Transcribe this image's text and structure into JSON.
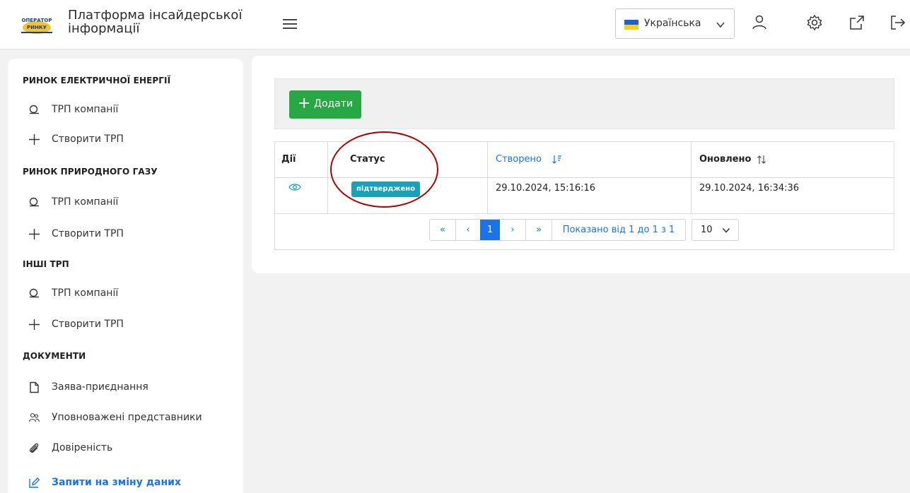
{
  "header": {
    "app_title": "Платформа інсайдерської інформації",
    "language": "Українська",
    "logo_text_top": "ОПЕРАТОР",
    "logo_text_mid": "РИНКУ"
  },
  "sidebar": {
    "sections": [
      {
        "title": "РИНОК ЕЛЕКТРИЧНОЇ ЕНЕРГІЇ",
        "items": [
          {
            "label": "ТРП компанії",
            "icon": "search-icon"
          },
          {
            "label": "Створити ТРП",
            "icon": "plus-icon"
          }
        ]
      },
      {
        "title": "РИНОК ПРИРОДНОГО ГАЗУ",
        "items": [
          {
            "label": "ТРП компанії",
            "icon": "search-icon"
          },
          {
            "label": "Створити ТРП",
            "icon": "plus-icon"
          }
        ]
      },
      {
        "title": "ІНШІ ТРП",
        "items": [
          {
            "label": "ТРП компанії",
            "icon": "search-icon"
          },
          {
            "label": "Створити ТРП",
            "icon": "plus-icon"
          }
        ]
      },
      {
        "title": "ДОКУМЕНТИ",
        "items": [
          {
            "label": "Заява-приєднання",
            "icon": "document-icon"
          },
          {
            "label": "Уповноважені представники",
            "icon": "users-icon"
          },
          {
            "label": "Довіреність",
            "icon": "paperclip-icon"
          },
          {
            "label": "Запити на зміну даних",
            "icon": "edit-icon",
            "active": true
          }
        ]
      }
    ]
  },
  "toolbar": {
    "add_label": "Додати"
  },
  "table": {
    "columns": [
      {
        "label": "Дії"
      },
      {
        "label": "Статус"
      },
      {
        "label": "Створено",
        "sort": "desc-active"
      },
      {
        "label": "Оновлено",
        "sort": "none"
      }
    ],
    "rows": [
      {
        "status": "підтверджено",
        "created": "29.10.2024, 15:16:16",
        "updated": "29.10.2024, 16:34:36"
      }
    ]
  },
  "pagination": {
    "first": "«",
    "prev": "‹",
    "current_page": "1",
    "next": "›",
    "last": "»",
    "summary": "Показано від 1 до 1 з 1",
    "page_size": "10"
  },
  "colors": {
    "accent": "#1a73e8",
    "add_button": "#28a745",
    "status_badge": "#17a2b8",
    "annotation": "#a80000"
  }
}
